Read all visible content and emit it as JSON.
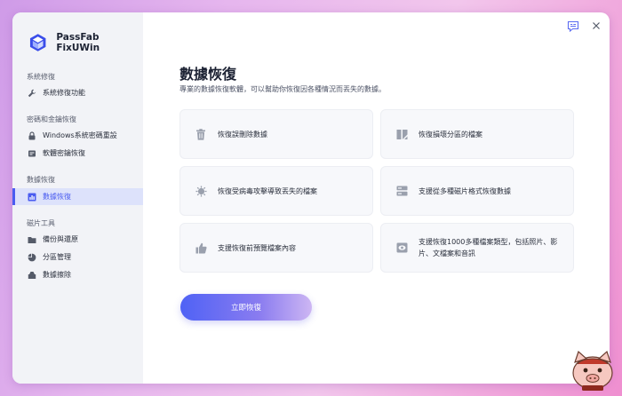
{
  "app": {
    "name": "PassFab FixUWin"
  },
  "sidebar": {
    "groups": [
      {
        "label": "系統修復"
      },
      {
        "label": "密碼和金鑰恢復"
      },
      {
        "label": "數據恢復"
      },
      {
        "label": "磁片工具"
      }
    ],
    "items": [
      {
        "label": "系統修復功能",
        "icon": "wrench-icon"
      },
      {
        "label": "Windows系統密碼重設",
        "icon": "lock-icon"
      },
      {
        "label": "軟體密鑰恢復",
        "icon": "key-icon"
      },
      {
        "label": "數據恢復",
        "icon": "bar-chart-icon",
        "active": true
      },
      {
        "label": "備份與還原",
        "icon": "folder-icon"
      },
      {
        "label": "分區管理",
        "icon": "pie-chart-icon"
      },
      {
        "label": "數據擦除",
        "icon": "eraser-icon"
      }
    ]
  },
  "main": {
    "title": "數據恢復",
    "subtitle": "專業的數據恢復軟體，可以幫助你恢復因各種情況而丟失的數據。",
    "features": [
      {
        "text": "恢復誤刪除數據",
        "icon": "trash-icon"
      },
      {
        "text": "恢復損壞分區的檔案",
        "icon": "partition-icon"
      },
      {
        "text": "恢復受病毒攻擊導致丟失的檔案",
        "icon": "virus-icon"
      },
      {
        "text": "支援從多種磁片格式恢復數據",
        "icon": "disk-icon"
      },
      {
        "text": "支援恢復前預覽檔案內容",
        "icon": "thumbs-up-icon"
      },
      {
        "text": "支援恢復1000多種檔案類型，包括照片、影片、文檔案和音訊",
        "icon": "eye-icon"
      }
    ],
    "cta_label": "立即恢復"
  },
  "colors": {
    "accent": "#4a5cf0",
    "sidebar_bg": "#f2f3f7",
    "card_bg": "#f7f8fb",
    "icon_gray": "#9aa0ad"
  }
}
